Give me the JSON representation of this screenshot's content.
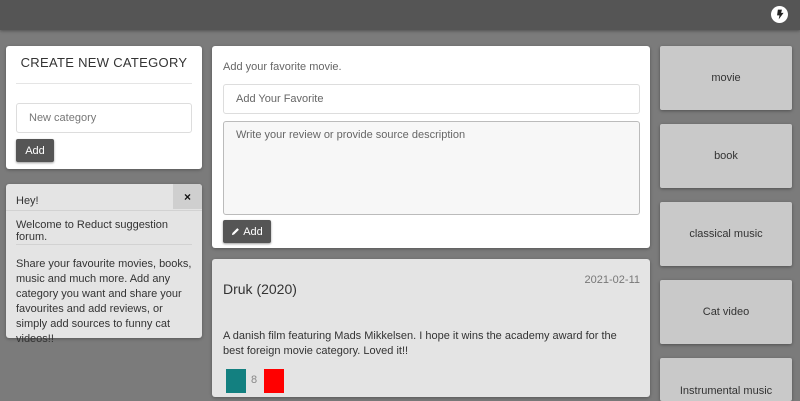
{
  "topbar": {
    "logout_icon": "logout-icon"
  },
  "create_category": {
    "title": "CREATE NEW CATEGORY",
    "input_placeholder": "New category",
    "input_value": "",
    "add_label": "Add"
  },
  "welcome": {
    "title": "Hey!",
    "close_label": "×",
    "welcome_line": "Welcome to Reduct suggestion forum.",
    "body": "Share your favourite movies, books, music and much more. Add any category you want and share your favourites and add reviews, or simply add sources to funny cat videos!!"
  },
  "favorite_form": {
    "prompt": "Add your favorite movie.",
    "title_placeholder": "Add Your Favorite",
    "review_placeholder": "Write your review or provide source description",
    "add_label": "Add",
    "add_icon": "pencil-icon"
  },
  "posts": [
    {
      "title": "Druk (2020)",
      "date": "2021-02-11",
      "body": "A danish film featuring Mads Mikkelsen. I hope it wins the academy award for the best foreign movie category. Loved it!!",
      "votes": "8",
      "upvote_color": "#138080",
      "downvote_color": "#ff0000"
    }
  ],
  "categories": [
    {
      "label": "movie"
    },
    {
      "label": "book"
    },
    {
      "label": "classical music"
    },
    {
      "label": "Cat video"
    },
    {
      "label": "Instrumental music"
    }
  ],
  "colors": {
    "background": "#7b7b7b",
    "topbar": "#555555",
    "button": "#555555",
    "tile": "#c9c9c9"
  }
}
